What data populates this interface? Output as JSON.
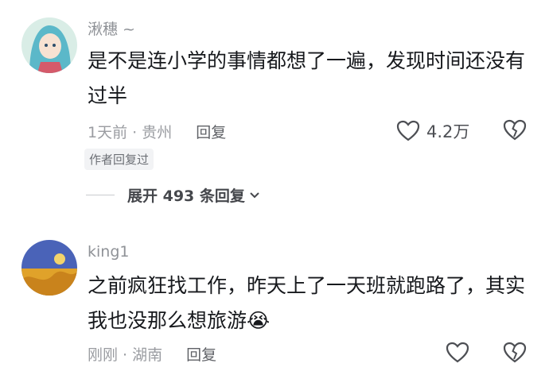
{
  "comments": [
    {
      "username": "湫穗 ~",
      "text": "是不是连小学的事情都想了一遍，发现时间还没有过半",
      "time_location": "1天前 · 贵州",
      "reply_label": "回复",
      "like_count": "4.2万",
      "author_badge": "作者回复过",
      "expand_label": "展开 493 条回复"
    },
    {
      "username": "king1",
      "text": "之前疯狂找工作，昨天上了一天班就跑路了，其实我也没那么想旅游😭",
      "time_location": "刚刚 · 湖南",
      "reply_label": "回复",
      "like_count": ""
    }
  ],
  "colors": {
    "text_primary": "#17191d",
    "text_secondary": "#8f9297",
    "badge_bg": "#f2f3f5"
  },
  "icons": [
    "heart-icon",
    "broken-heart-icon",
    "chevron-down-icon"
  ]
}
